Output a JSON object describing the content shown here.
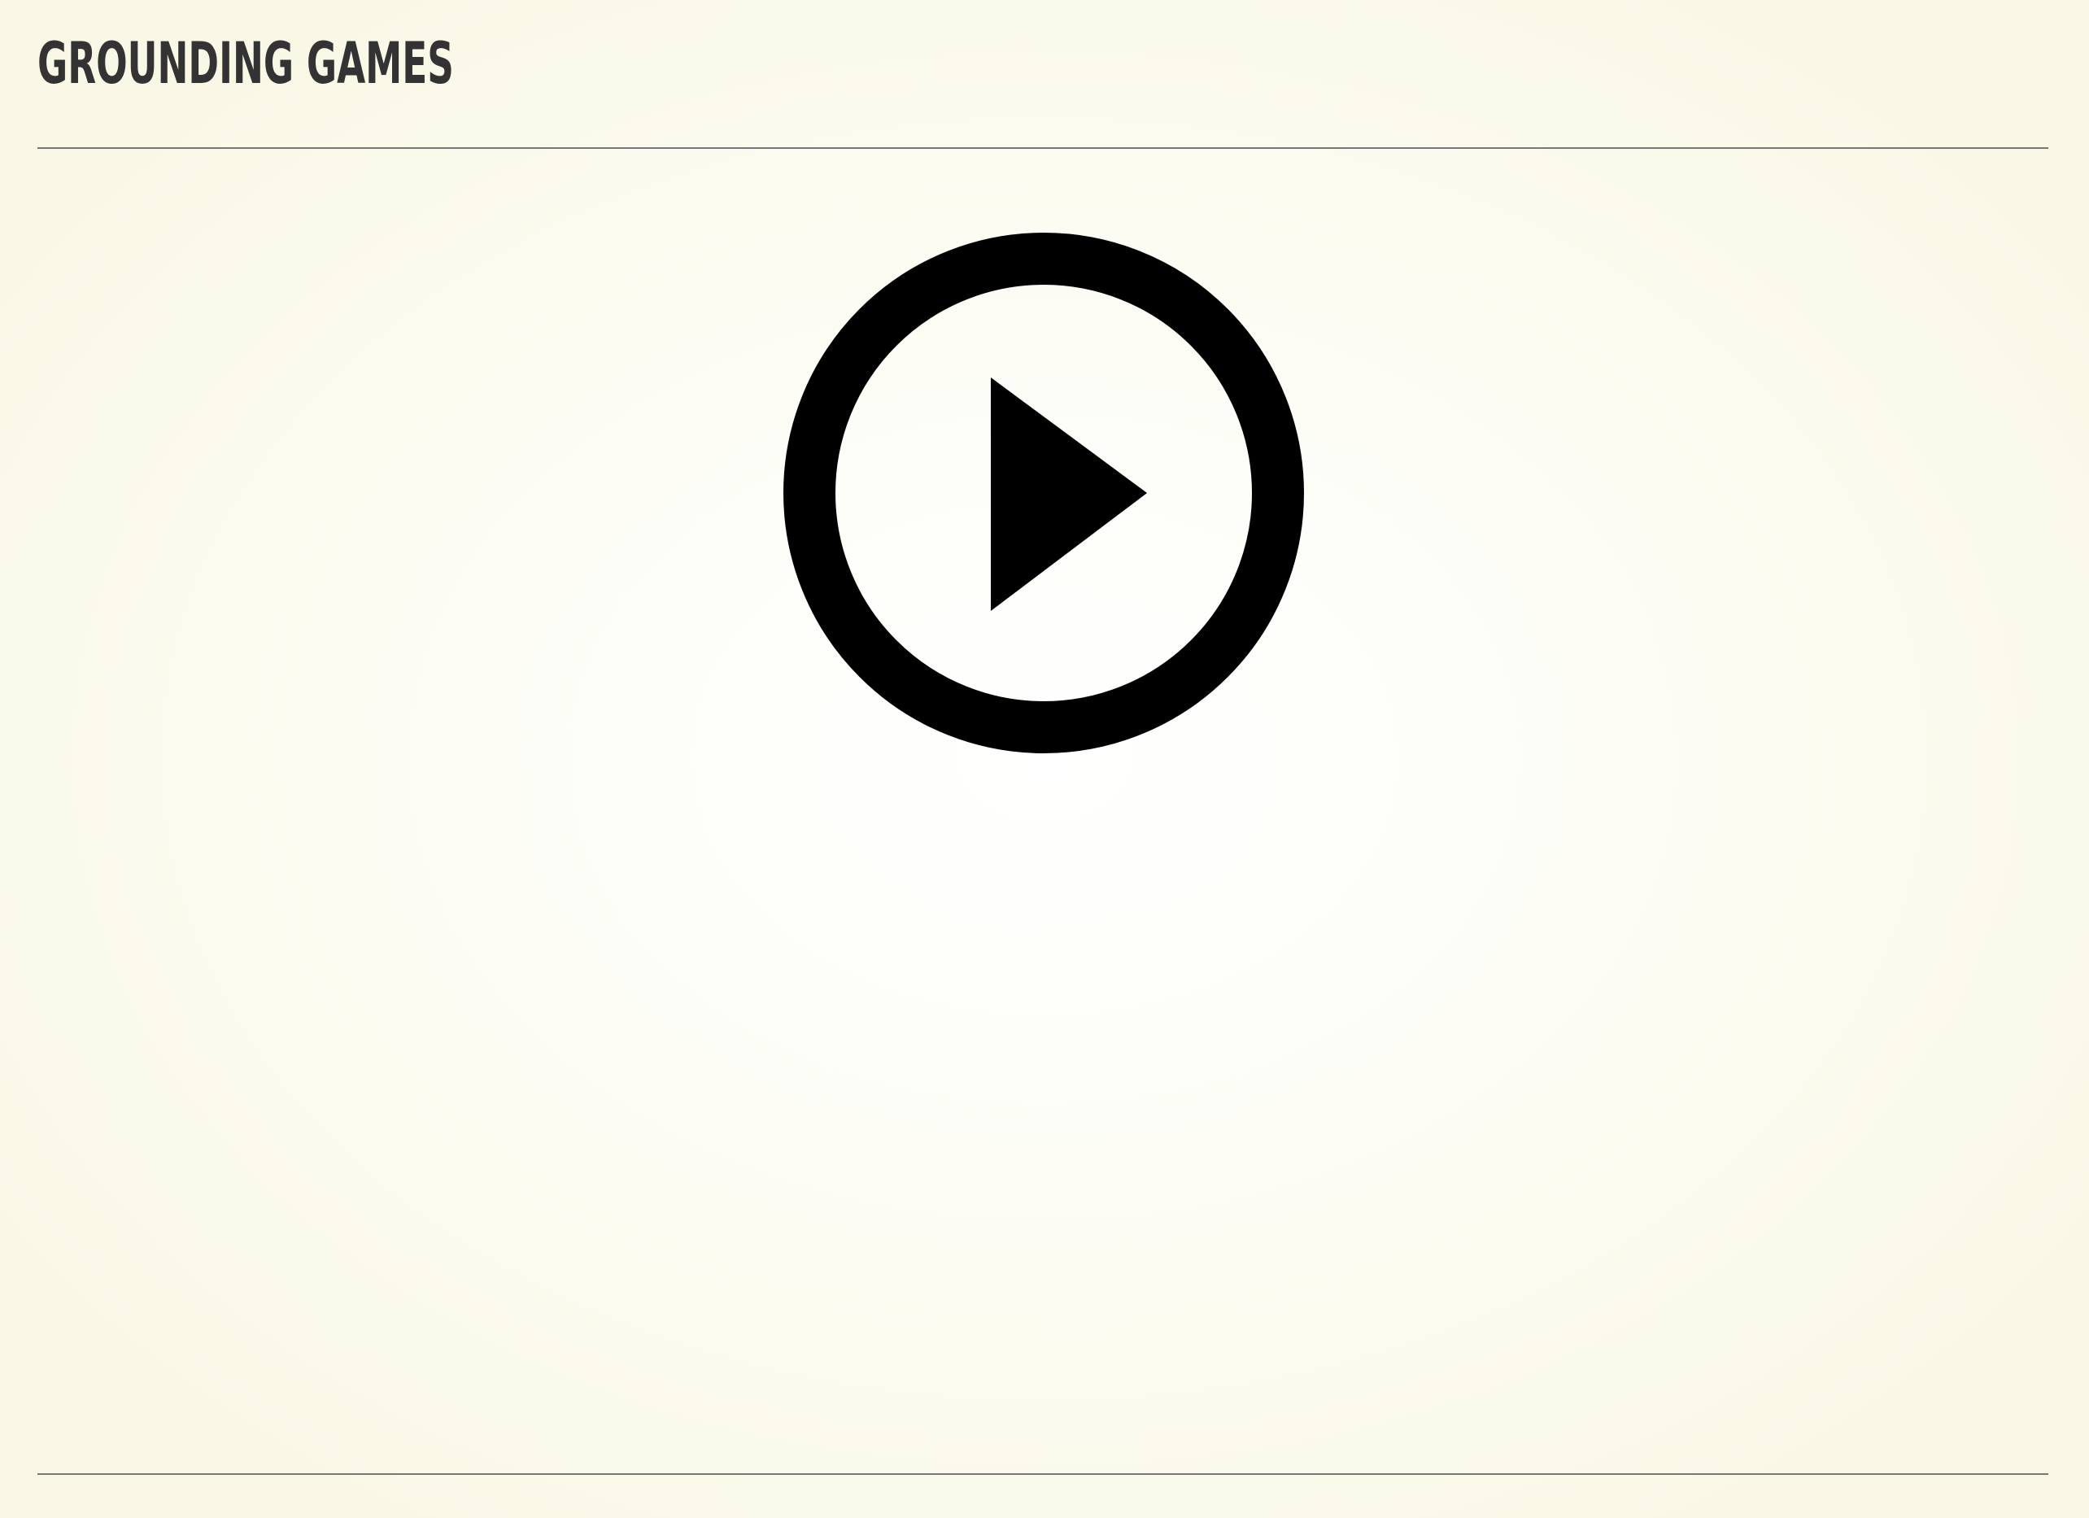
{
  "header": {
    "title": "GROUNDING GAMES"
  },
  "player": {
    "play_button_icon": "play-circle-icon"
  },
  "colors": {
    "title_text": "#333333",
    "rule": "#777777",
    "icon": "#000000",
    "background_center": "#ffffff",
    "background_edge": "#f9f8e6"
  }
}
